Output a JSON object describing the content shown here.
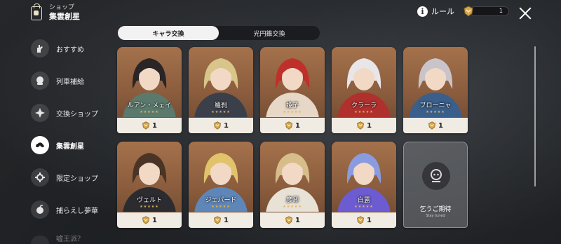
{
  "header": {
    "subtitle": "ショップ",
    "title": "集雲創星"
  },
  "top": {
    "rule_label": "ルール",
    "currency_amount": "1"
  },
  "sidebar": {
    "items": [
      {
        "label": "おすすめ",
        "icon": "hand-icon",
        "active": false
      },
      {
        "label": "列車補給",
        "icon": "mascot-icon",
        "active": false
      },
      {
        "label": "交換ショップ",
        "icon": "star-diamond-icon",
        "active": false
      },
      {
        "label": "集雲創星",
        "icon": "cloud-star-icon",
        "active": true
      },
      {
        "label": "限定ショップ",
        "icon": "gear-pass-icon",
        "active": false
      },
      {
        "label": "捕らえし夢華",
        "icon": "fruit-icon",
        "active": false
      },
      {
        "label": "嘘王派？",
        "icon": "partial-icon",
        "active": false
      }
    ]
  },
  "tabs": [
    {
      "label": "キャラ交換",
      "active": true
    },
    {
      "label": "光円錐交換",
      "active": false
    }
  ],
  "cards": [
    {
      "name": "ルアン・メェイ",
      "price": "1",
      "stars": "★★★★★",
      "hair": "#2a2526",
      "accent": "#5b7a6d"
    },
    {
      "name": "羅刹",
      "price": "1",
      "stars": "★★★★★",
      "hair": "#d8c58a",
      "accent": "#3b3f4a"
    },
    {
      "name": "姫子",
      "price": "1",
      "stars": "★★★★★",
      "hair": "#c0302b",
      "accent": "#e6d7c6"
    },
    {
      "name": "クラーラ",
      "price": "1",
      "stars": "★★★★★",
      "hair": "#e9e6ea",
      "accent": "#b0302d"
    },
    {
      "name": "ブローニャ",
      "price": "1",
      "stars": "★★★★★",
      "hair": "#c9c4c9",
      "accent": "#3a5f8a"
    },
    {
      "name": "ヴェルト",
      "price": "1",
      "stars": "★★★★★",
      "hair": "#4a3426",
      "accent": "#2b2b30"
    },
    {
      "name": "ジェパード",
      "price": "1",
      "stars": "★★★★★",
      "hair": "#e0c36a",
      "accent": "#5f86b8"
    },
    {
      "name": "彦卿",
      "price": "1",
      "stars": "★★★★★",
      "hair": "#d7bd8a",
      "accent": "#e7e1d6"
    },
    {
      "name": "白露",
      "price": "1",
      "stars": "★★★★★",
      "hair": "#8a9be0",
      "accent": "#6c5bd1"
    }
  ],
  "placeholder": {
    "label": "乞うご期待",
    "sub": "Stay tuned"
  },
  "colors": {
    "card_bg": "#a4714b",
    "price_bg": "#f1ece3",
    "coin": "#d7a84a",
    "tab_active": "#f2f2f2"
  }
}
